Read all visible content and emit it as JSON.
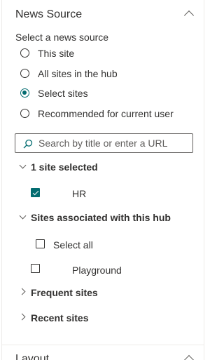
{
  "news_source": {
    "title": "News Source",
    "select_label": "Select a news source",
    "options": [
      {
        "label": "This site",
        "checked": false
      },
      {
        "label": "All sites in the hub",
        "checked": false
      },
      {
        "label": "Select sites",
        "checked": true
      },
      {
        "label": "Recommended for current user",
        "checked": false
      }
    ],
    "search": {
      "placeholder": "Search by title or enter a URL",
      "value": ""
    },
    "groups": {
      "selected": {
        "label": "1 site selected",
        "items": [
          {
            "label": "HR",
            "checked": true
          }
        ]
      },
      "hub": {
        "label": "Sites associated with this hub",
        "select_all": "Select all",
        "items": [
          {
            "label": "Playground",
            "checked": false
          }
        ]
      },
      "frequent": {
        "label": "Frequent sites"
      },
      "recent": {
        "label": "Recent sites"
      }
    }
  },
  "layout": {
    "title": "Layout"
  },
  "colors": {
    "accent": "#036c70",
    "text": "#323130",
    "border": "#605e5c"
  }
}
